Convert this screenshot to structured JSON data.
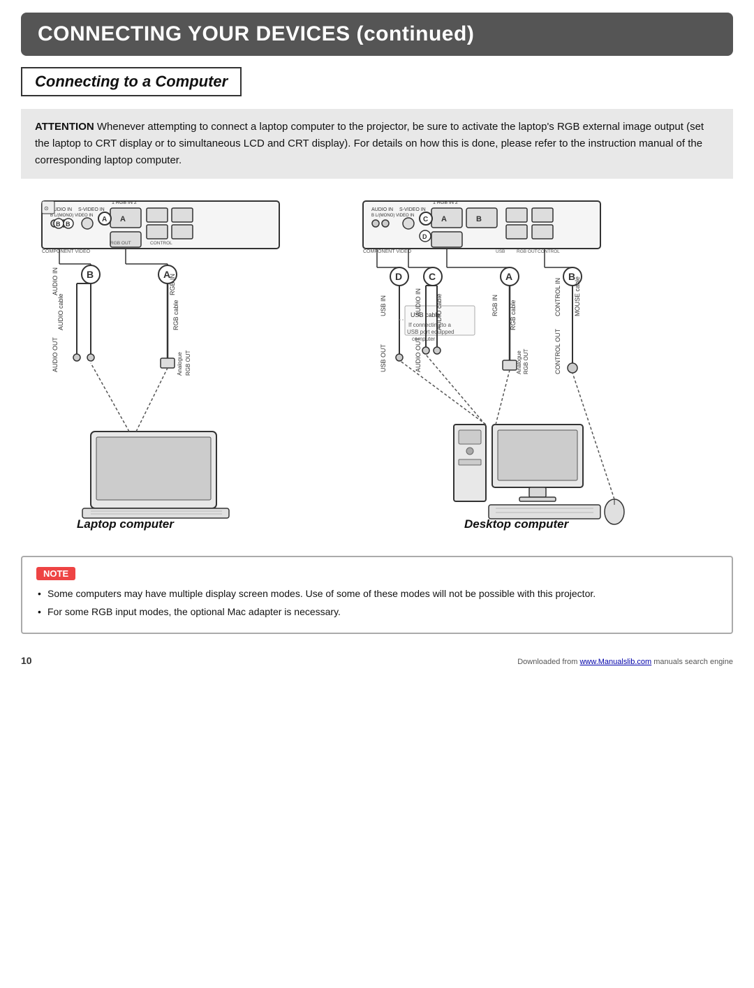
{
  "header": {
    "title": "CONNECTING YOUR DEVICES (continued)"
  },
  "section": {
    "title": "Connecting to a Computer"
  },
  "attention": {
    "label": "ATTENTION",
    "text": "Whenever attempting to connect a laptop computer to the projector, be sure to activate the laptop's RGB external image output (set the laptop to CRT display or to simultaneous LCD and CRT display). For details on how this is done, please refer to the instruction manual of the corresponding laptop computer."
  },
  "diagram_left": {
    "label": "Laptop computer",
    "badges": [
      "A",
      "B"
    ],
    "cables": [
      "RGB cable",
      "AUDIO cable"
    ],
    "port_labels": [
      "RGB IN",
      "AUDIO IN",
      "AUDIO OUT"
    ],
    "analogue_label": "Analogue RGB OUT"
  },
  "diagram_right": {
    "label": "Desktop computer",
    "badges": [
      "A",
      "B",
      "C",
      "D"
    ],
    "cables": [
      "RGB cable",
      "AUDIO cable",
      "MOUSE cable"
    ],
    "port_labels": [
      "RGB IN",
      "AUDIO IN",
      "AUDIO OUT",
      "USB IN",
      "USB OUT",
      "CONTROL IN",
      "CONTROL OUT"
    ],
    "usb_note": "USB cable",
    "usb_note2": "If connecting to a USB port equipped computer",
    "analogue_label": "Analogue RGB OUT"
  },
  "note": {
    "label": "NOTE",
    "items": [
      "Some computers may have multiple display screen modes. Use of some of these modes will not be possible with this projector.",
      "For some RGB input modes, the optional Mac adapter is necessary."
    ]
  },
  "footer": {
    "page_number": "10",
    "downloaded_text": "Downloaded from ",
    "link_text": "www.Manualslib.com",
    "link_url": "#",
    "suffix": " manuals search engine"
  }
}
